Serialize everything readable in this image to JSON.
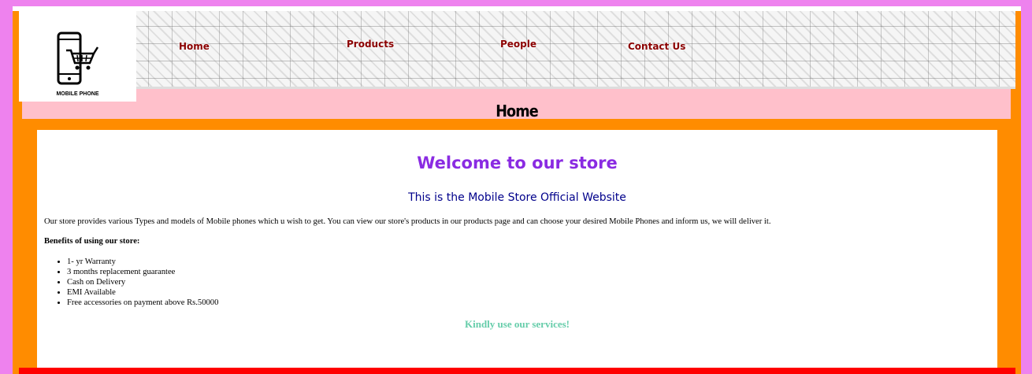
{
  "header": {
    "logo_text": "MOBILE PHONE",
    "nav": [
      "Home",
      "Products",
      "People",
      "Contact Us"
    ]
  },
  "page_title": "Home",
  "main": {
    "welcome": "Welcome to our store",
    "subtitle": "This is the Mobile Store Official Website",
    "description": "Our store provides various Types and models of Mobile phones which u wish to get. You can view our store's products in our products page and can choose your desired Mobile Phones and inform us, we will deliver it.",
    "benefits_title": "Benefits of using our store:",
    "benefits": [
      "1- yr Warranty",
      "3 months replacement guarantee",
      "Cash on Delivery",
      "EMI Available",
      "Free accessories on payment above Rs.50000"
    ],
    "closing": "Kindly use our services!"
  },
  "colors": {
    "page_border": "#ee82ee",
    "frame": "#ff8c00",
    "title_bar": "#ffc0cb",
    "nav_text": "#8b0000",
    "welcome": "#8a2be2",
    "subtitle": "#00008b",
    "closing": "#66cdaa",
    "footer": "#ff0000"
  }
}
